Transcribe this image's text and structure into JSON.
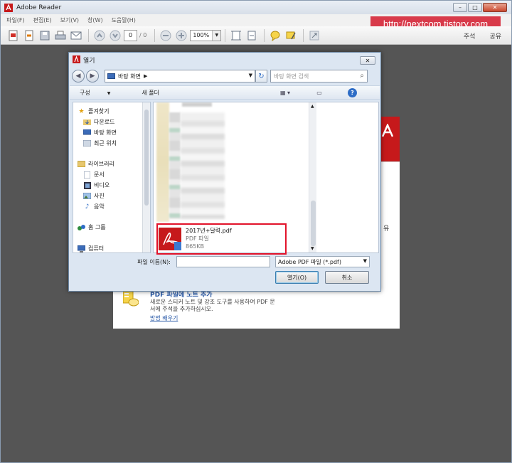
{
  "app": {
    "title": "Adobe Reader",
    "window_controls": [
      "–",
      "□",
      "✕"
    ]
  },
  "menubar": {
    "items": [
      "파일(F)",
      "편집(E)",
      "보기(V)",
      "창(W)",
      "도움말(H)"
    ]
  },
  "toolbar": {
    "page_value": "0",
    "page_total": "/ 0",
    "zoom_value": "100%",
    "right_items": [
      "주석",
      "공유"
    ]
  },
  "watermark": "http://nextcom.tistory.com",
  "document": {
    "right_text": "유",
    "tile_title": "PDF 파일에 노트 추가",
    "tile_desc": "새로운 스티커 노트 및 강조 도구를 사용하여 PDF 문서에 주석을 추가하십시오.",
    "tile_link": "방법 배우기"
  },
  "dialog": {
    "title": "열기",
    "close_label": "✕",
    "address_path": "바탕 화면",
    "search_placeholder": "바탕 화면 검색",
    "commands": {
      "organize": "구성",
      "new_folder": "새 폴더"
    },
    "nav_items": [
      {
        "label": "즐겨찾기",
        "icon": "star-icon"
      },
      {
        "label": "다운로드",
        "icon": "download-folder-icon"
      },
      {
        "label": "바탕 화면",
        "icon": "desktop-icon"
      },
      {
        "label": "최근 위치",
        "icon": "recent-places-icon"
      },
      {
        "label": "라이브러리",
        "icon": "library-icon"
      },
      {
        "label": "문서",
        "icon": "documents-icon"
      },
      {
        "label": "비디오",
        "icon": "video-icon"
      },
      {
        "label": "사진",
        "icon": "pictures-icon"
      },
      {
        "label": "음악",
        "icon": "music-icon"
      },
      {
        "label": "홈 그룹",
        "icon": "homegroup-icon"
      },
      {
        "label": "컴퓨터",
        "icon": "computer-icon"
      }
    ],
    "file": {
      "name": "2017년+달력.pdf",
      "type": "PDF 파일",
      "size": "865KB"
    },
    "filename_label": "파일 이름(N):",
    "filename_value": "",
    "filetype_value": "Adobe PDF 파일 (*.pdf)",
    "open_button": "열기(O)",
    "cancel_button": "취소"
  },
  "colors": {
    "highlight": "#e2132a",
    "adobe_red": "#c6191b",
    "watermark_bg": "#d83a4a"
  }
}
